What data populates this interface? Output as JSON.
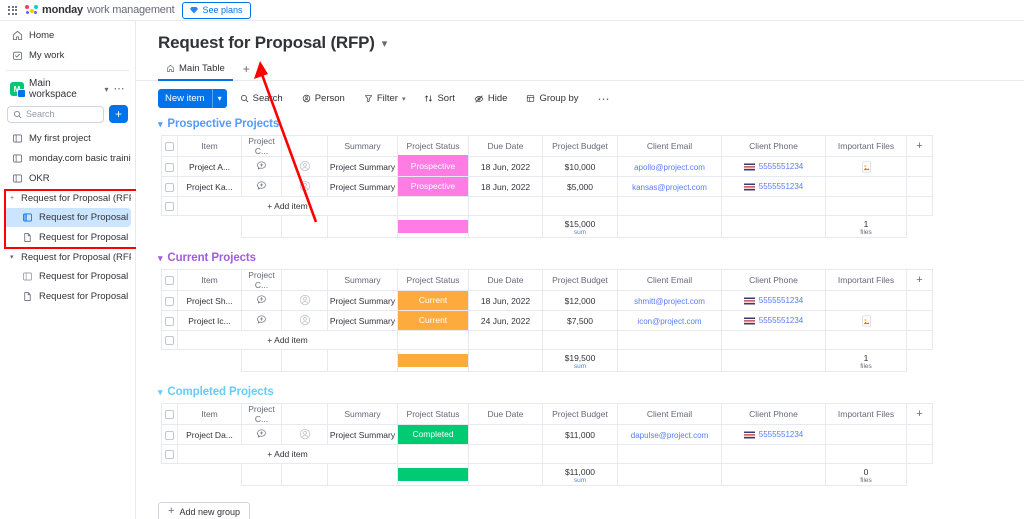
{
  "topbar": {
    "apps_icon": "waffle-grid-icon",
    "logo_icon": "monday-logo-icon",
    "brand_name": "monday",
    "brand_product": "work management",
    "see_plans_label": "See plans",
    "see_plans_icon": "gem-icon"
  },
  "sidebar": {
    "nav": [
      {
        "label": "Home",
        "icon": "home-icon"
      },
      {
        "label": "My work",
        "icon": "my-work-icon"
      }
    ],
    "workspace": {
      "avatar_letter": "M",
      "name": "Main workspace",
      "caret_icon": "chevron-down-icon",
      "more_icon": "ellipsis-icon"
    },
    "search": {
      "placeholder": "Search",
      "value": "",
      "icon": "search-icon"
    },
    "add_button_label": "+",
    "boards": [
      {
        "label": "My first project",
        "icon": "board-icon",
        "type": "board",
        "selected": false
      },
      {
        "label": "monday.com basic training",
        "icon": "board-icon",
        "type": "board",
        "selected": false
      },
      {
        "label": "OKR",
        "icon": "board-icon",
        "type": "board",
        "selected": false
      }
    ],
    "groups": [
      {
        "label": "Request for Proposal (RFP)",
        "caret": "+",
        "highlighted": true,
        "children": [
          {
            "label": "Request for Proposal (RF...",
            "icon": "board-icon",
            "selected": true
          },
          {
            "label": "Request for Proposal (RF...",
            "icon": "doc-icon",
            "selected": false
          }
        ]
      },
      {
        "label": "Request for Proposal (RFP)",
        "caret": "▾",
        "highlighted": false,
        "children": [
          {
            "label": "Request for Proposal (RF...",
            "icon": "board-icon",
            "selected": false
          },
          {
            "label": "Request for Proposal (RF...",
            "icon": "doc-icon",
            "selected": false
          }
        ]
      }
    ]
  },
  "board": {
    "title": "Request for Proposal (RFP)",
    "title_caret_icon": "chevron-down-icon",
    "tabs": [
      {
        "label": "Main Table",
        "icon": "home-icon",
        "active": true
      }
    ],
    "add_tab_label": "+",
    "toolbar": {
      "new_item_label": "New item",
      "new_item_caret": "chevron-down-icon",
      "buttons": [
        {
          "label": "Search",
          "icon": "search-icon",
          "caret": false
        },
        {
          "label": "Person",
          "icon": "person-icon",
          "caret": false
        },
        {
          "label": "Filter",
          "icon": "filter-icon",
          "caret": true
        },
        {
          "label": "Sort",
          "icon": "sort-icon",
          "caret": false
        },
        {
          "label": "Hide",
          "icon": "eye-off-icon",
          "caret": false
        },
        {
          "label": "Group by",
          "icon": "group-by-icon",
          "caret": false
        }
      ],
      "more_icon": "ellipsis-icon"
    },
    "columns": [
      "Item",
      "Project C...",
      "Summary",
      "Project Status",
      "Due Date",
      "Project Budget",
      "Client Email",
      "Client Phone",
      "Important Files"
    ],
    "add_column_label": "+",
    "add_item_label": "+ Add item",
    "add_group_label": "Add new group",
    "add_group_icon": "plus-icon",
    "sum_label": "sum",
    "files_label": "files",
    "colors": {
      "prospective": "#ff7ce5",
      "current": "#fdab3d",
      "completed": "#00ca72",
      "group_blue": "#579bfc",
      "group_purple": "#a25ddc",
      "group_teal": "#66ccff",
      "accent_blue": "#0073ea",
      "link_blue": "#597bfc",
      "annotation_red": "#ff0000"
    },
    "groups": [
      {
        "name": "Prospective Projects",
        "color": "#579bfc",
        "title_color": "#579bfc",
        "status_color": "#ff7ce5",
        "rows": [
          {
            "item": "Project A...",
            "conversation_icon": "chat-plus-icon",
            "person_icon": "person-avatar-icon",
            "summary": "Project Summary",
            "status": "Prospective",
            "due_date": "18 Jun, 2022",
            "budget": "$10,000",
            "email": "apollo@project.com",
            "phone": "5555551234",
            "phone_flag_icon": "flag-icon",
            "file_icon": "image-file-icon"
          },
          {
            "item": "Project Ka...",
            "conversation_icon": "chat-plus-icon",
            "person_icon": "person-avatar-icon",
            "summary": "Project Summary",
            "status": "Prospective",
            "due_date": "18 Jun, 2022",
            "budget": "$5,000",
            "email": "kansas@project.com",
            "phone": "5555551234",
            "phone_flag_icon": "flag-icon",
            "file_icon": ""
          }
        ],
        "summary": {
          "budget": "$15,000",
          "budget_label": "sum",
          "files": "1",
          "files_label": "files"
        }
      },
      {
        "name": "Current Projects",
        "color": "#a25ddc",
        "title_color": "#a25ddc",
        "status_color": "#fdab3d",
        "rows": [
          {
            "item": "Project Sh...",
            "conversation_icon": "chat-plus-icon",
            "person_icon": "person-avatar-icon",
            "summary": "Project Summary",
            "status": "Current",
            "due_date": "18 Jun, 2022",
            "budget": "$12,000",
            "email": "shmitt@project.com",
            "phone": "5555551234",
            "phone_flag_icon": "flag-icon",
            "file_icon": ""
          },
          {
            "item": "Project Ic...",
            "conversation_icon": "chat-plus-icon",
            "person_icon": "person-avatar-icon",
            "summary": "Project Summary",
            "status": "Current",
            "due_date": "24 Jun, 2022",
            "budget": "$7,500",
            "email": "icon@project.com",
            "phone": "5555551234",
            "phone_flag_icon": "flag-icon",
            "file_icon": "image-file-icon"
          }
        ],
        "summary": {
          "budget": "$19,500",
          "budget_label": "sum",
          "files": "1",
          "files_label": "files"
        }
      },
      {
        "name": "Completed Projects",
        "color": "#579bfc",
        "title_color": "#66ccff",
        "status_color": "#00ca72",
        "rows": [
          {
            "item": "Project Da...",
            "conversation_icon": "chat-plus-icon",
            "person_icon": "person-avatar-icon",
            "summary": "Project Summary",
            "status": "Completed",
            "due_date": "",
            "budget": "$11,000",
            "email": "dapulse@project.com",
            "phone": "5555551234",
            "phone_flag_icon": "flag-icon",
            "file_icon": ""
          }
        ],
        "summary": {
          "budget": "$11,000",
          "budget_label": "sum",
          "files": "0",
          "files_label": "files"
        }
      }
    ]
  }
}
